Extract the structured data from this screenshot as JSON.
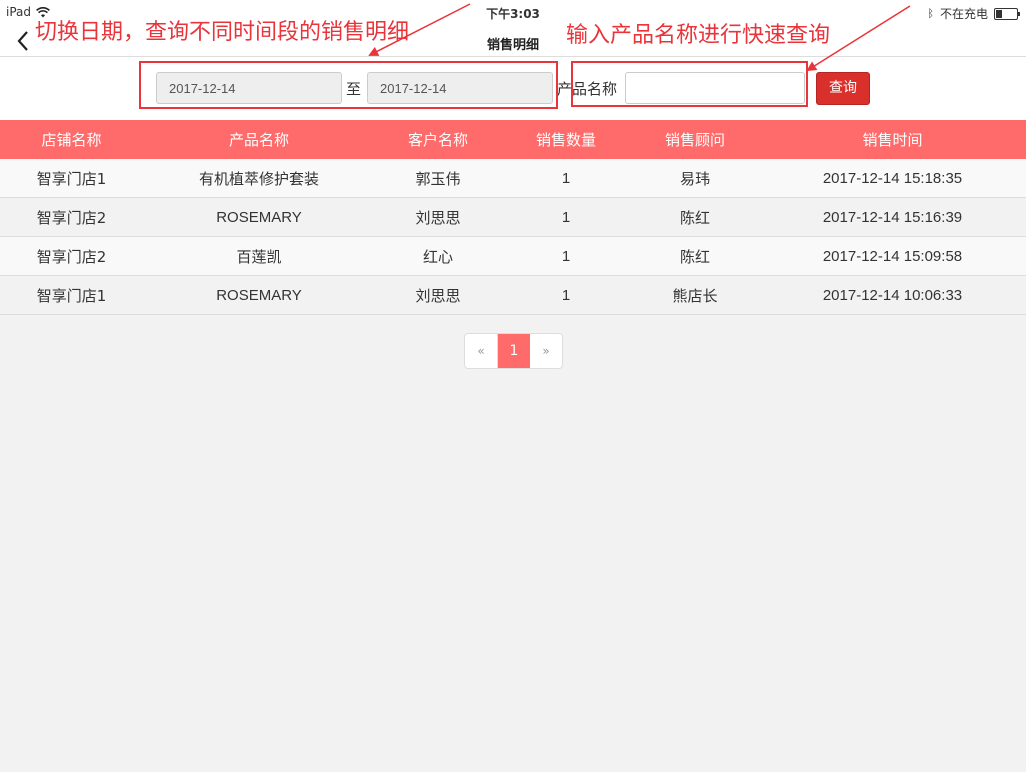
{
  "statusbar": {
    "device": "iPad",
    "time": "下午3:03",
    "charge_status": "不在充电"
  },
  "navbar": {
    "back_icon": "chevron-left-icon",
    "title": "销售明细"
  },
  "filters": {
    "start_date": "2017-12-14",
    "to_label": "至",
    "end_date": "2017-12-14",
    "product_label": "产品名称",
    "product_value": "",
    "query_label": "查询"
  },
  "annotations": {
    "date_note": "切换日期，查询不同时间段的销售明细",
    "product_note": "输入产品名称进行快速查询",
    "color": "#e8343a"
  },
  "table": {
    "headers": [
      "店铺名称",
      "产品名称",
      "客户名称",
      "销售数量",
      "销售顾问",
      "销售时间"
    ],
    "rows": [
      [
        "智享门店1",
        "有机植萃修护套装",
        "郭玉伟",
        "1",
        "易玮",
        "2017-12-14 15:18:35"
      ],
      [
        "智享门店2",
        "ROSEMARY",
        "刘思思",
        "1",
        "陈红",
        "2017-12-14 15:16:39"
      ],
      [
        "智享门店2",
        "百莲凯",
        "红心",
        "1",
        "陈红",
        "2017-12-14 15:09:58"
      ],
      [
        "智享门店1",
        "ROSEMARY",
        "刘思思",
        "1",
        "熊店长",
        "2017-12-14 10:06:33"
      ]
    ]
  },
  "pagination": {
    "prev": "«",
    "current": "1",
    "next": "»"
  },
  "colors": {
    "header_bg": "#ff6b6b",
    "query_button": "#d9302c",
    "annotation": "#e8343a"
  }
}
